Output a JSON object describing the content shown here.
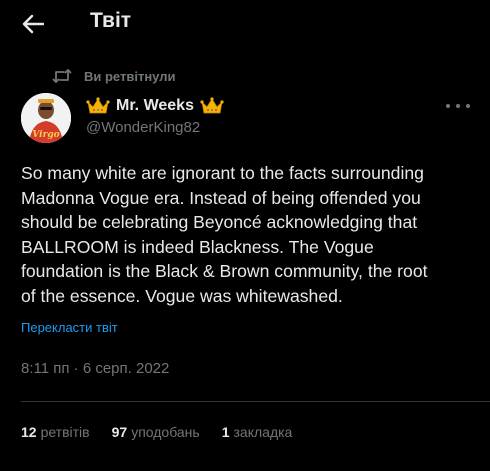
{
  "header": {
    "title": "Твіт",
    "back_icon": "arrow-left-icon"
  },
  "retweet": {
    "label": "Ви ретвітнули",
    "icon": "retweet-icon"
  },
  "author": {
    "name": "Mr. Weeks",
    "handle": "@WonderKing82",
    "avatar_caption": "Virgo",
    "name_decoration_icon": "crown-icon"
  },
  "tweet": {
    "lines": [
      "So many white are ignorant to the facts surrounding",
      "Madonna Vogue era. Instead of being offended you",
      "should be celebrating Beyoncé acknowledging that",
      "BALLROOM is indeed Blackness. The Vogue",
      "foundation is the Black & Brown community, the root",
      "of the essence. Vogue was whitewashed."
    ],
    "translate_label": "Перекласти твіт",
    "timestamp": "8:11 пп · 6 серп. 2022"
  },
  "stats": {
    "retweets_count": "12",
    "retweets_label": "ретвітів",
    "likes_count": "97",
    "likes_label": "уподобань",
    "bookmarks_count": "1",
    "bookmarks_label": "закладка"
  },
  "colors": {
    "background": "#000000",
    "primary_text": "#e7e9ea",
    "secondary_text": "#71767b",
    "link": "#1d9bf0",
    "divider": "#2f3336",
    "crown": "#f5b400"
  }
}
